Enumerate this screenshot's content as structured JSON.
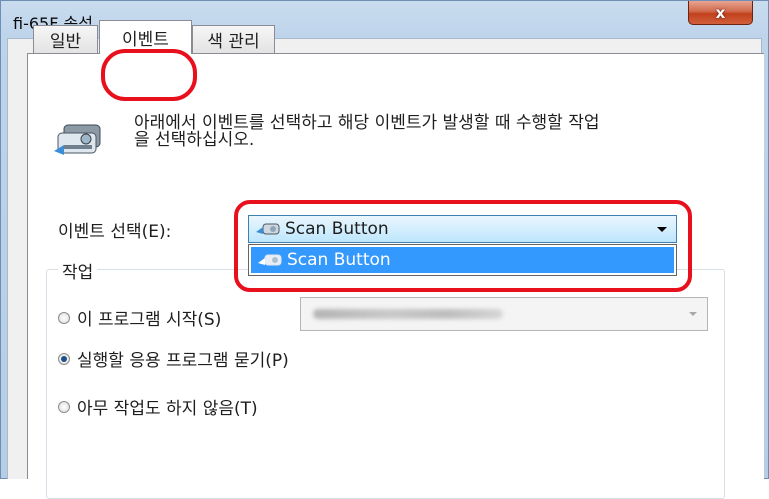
{
  "window": {
    "title": "fi-65F 속성",
    "close_label": "x"
  },
  "tabs": [
    {
      "label": "일반",
      "active": false
    },
    {
      "label": "이벤트",
      "active": true
    },
    {
      "label": "색 관리",
      "active": false
    }
  ],
  "event_tab": {
    "description_line1": "아래에서 이벤트를 선택하고 해당 이벤트가 발생할 때 수행할 작업",
    "description_line2": "을 선택하십시오.",
    "event_select_label": "이벤트 선택(E):",
    "event_select_value": "Scan Button",
    "dropdown_options": [
      "Scan Button"
    ],
    "action_group_label": "작업",
    "radio_options": [
      {
        "label": "이 프로그램 시작(S)",
        "checked": false
      },
      {
        "label": "실행할 응용 프로그램 묻기(P)",
        "checked": true
      },
      {
        "label": "아무 작업도 하지 않음(T)",
        "checked": false
      }
    ]
  },
  "colors": {
    "highlight": "#e8101c",
    "selection": "#3399ff"
  },
  "icons": {
    "scanner": "scanner-icon",
    "scan_button": "scan-button-icon"
  }
}
